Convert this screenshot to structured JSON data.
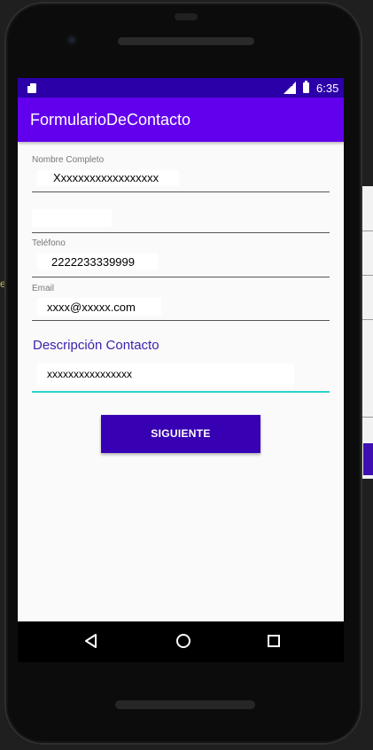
{
  "status_bar": {
    "network": "LTE",
    "time": "6:35"
  },
  "app_bar": {
    "title": "FormularioDeContacto"
  },
  "form": {
    "nombre": {
      "label": "Nombre Completo",
      "value": "Xxxxxxxxxxxxxxxxxx"
    },
    "fecha": {
      "label": "",
      "value": ""
    },
    "telefono": {
      "label": "Teléfono",
      "value": "2222233339999"
    },
    "email": {
      "label": "Email",
      "value": "xxxx@xxxxx.com"
    },
    "descripcion": {
      "label": "Descripción Contacto",
      "value": "xxxxxxxxxxxxxxxx"
    }
  },
  "button": {
    "label": "SIGUIENTE"
  },
  "background": {
    "stray_letter": "e"
  },
  "colors": {
    "status_bar": "#2b00a8",
    "app_bar": "#6200ee",
    "button": "#3700b3",
    "focus_underline": "#2bd3cf",
    "accent_label": "#3d1fae"
  },
  "icons": [
    "sd-card-icon",
    "lte-signal-icon",
    "battery-icon",
    "back-icon",
    "home-icon",
    "recents-icon"
  ]
}
